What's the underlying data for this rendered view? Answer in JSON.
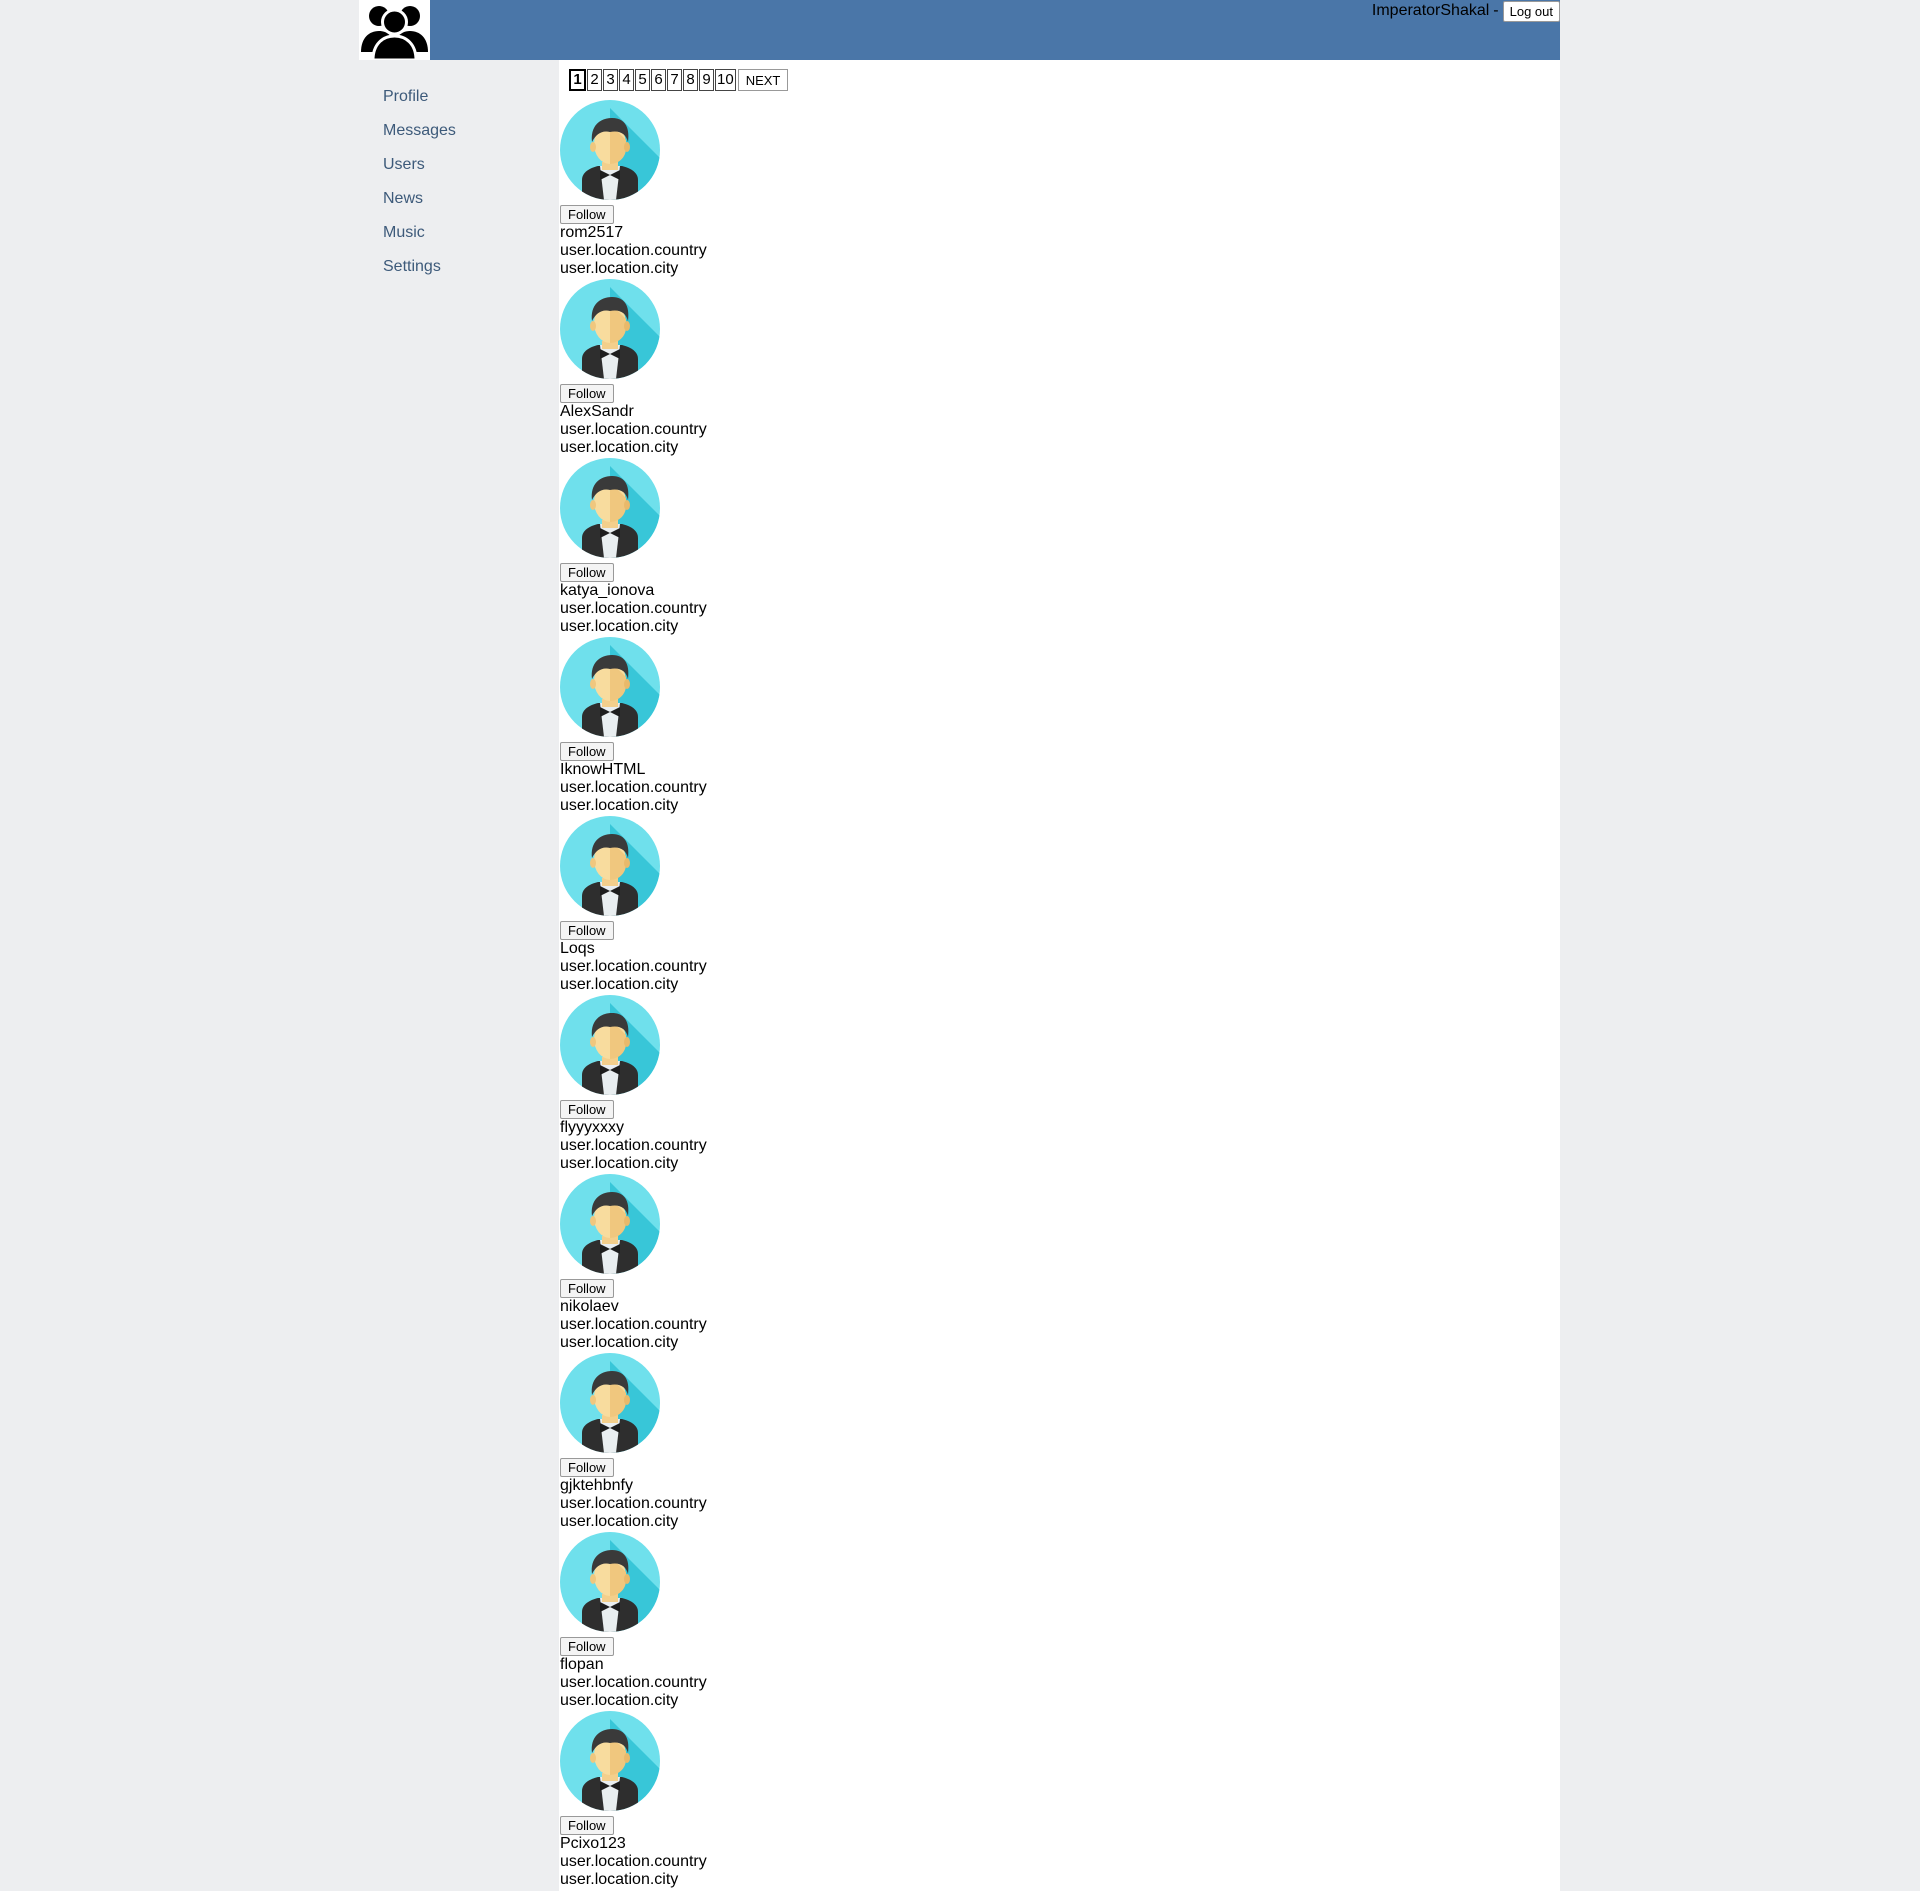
{
  "header": {
    "logo_icon": "users-group-icon",
    "username": "ImperatorShakal",
    "separator": "-",
    "logout_label": "Log out",
    "background": "#4a76a8"
  },
  "nav": [
    {
      "label": "Profile"
    },
    {
      "label": "Messages"
    },
    {
      "label": "Users"
    },
    {
      "label": "News"
    },
    {
      "label": "Music"
    },
    {
      "label": "Settings"
    }
  ],
  "pagination": {
    "pages": [
      "1",
      "2",
      "3",
      "4",
      "5",
      "6",
      "7",
      "8",
      "9",
      "10"
    ],
    "current": "1",
    "next_label": "NEXT"
  },
  "users": [
    {
      "name": "rom2517",
      "country": "user.location.country",
      "city": "user.location.city",
      "follow_label": "Follow",
      "avatar_icon": "man-avatar-icon"
    },
    {
      "name": "AlexSandr",
      "country": "user.location.country",
      "city": "user.location.city",
      "follow_label": "Follow",
      "avatar_icon": "man-avatar-icon"
    },
    {
      "name": "katya_ionova",
      "country": "user.location.country",
      "city": "user.location.city",
      "follow_label": "Follow",
      "avatar_icon": "man-avatar-icon"
    },
    {
      "name": "IknowHTML",
      "country": "user.location.country",
      "city": "user.location.city",
      "follow_label": "Follow",
      "avatar_icon": "man-avatar-icon"
    },
    {
      "name": "Loqs",
      "country": "user.location.country",
      "city": "user.location.city",
      "follow_label": "Follow",
      "avatar_icon": "man-avatar-icon"
    },
    {
      "name": "flyyyxxxy",
      "country": "user.location.country",
      "city": "user.location.city",
      "follow_label": "Follow",
      "avatar_icon": "man-avatar-icon"
    },
    {
      "name": "nikolaev",
      "country": "user.location.country",
      "city": "user.location.city",
      "follow_label": "Follow",
      "avatar_icon": "man-avatar-icon"
    },
    {
      "name": "gjktehbnfy",
      "country": "user.location.country",
      "city": "user.location.city",
      "follow_label": "Follow",
      "avatar_icon": "man-avatar-icon"
    },
    {
      "name": "flopan",
      "country": "user.location.country",
      "city": "user.location.city",
      "follow_label": "Follow",
      "avatar_icon": "man-avatar-icon"
    },
    {
      "name": "Pcixo123",
      "country": "user.location.country",
      "city": "user.location.city",
      "follow_label": "Follow",
      "avatar_icon": "man-avatar-icon"
    }
  ]
}
